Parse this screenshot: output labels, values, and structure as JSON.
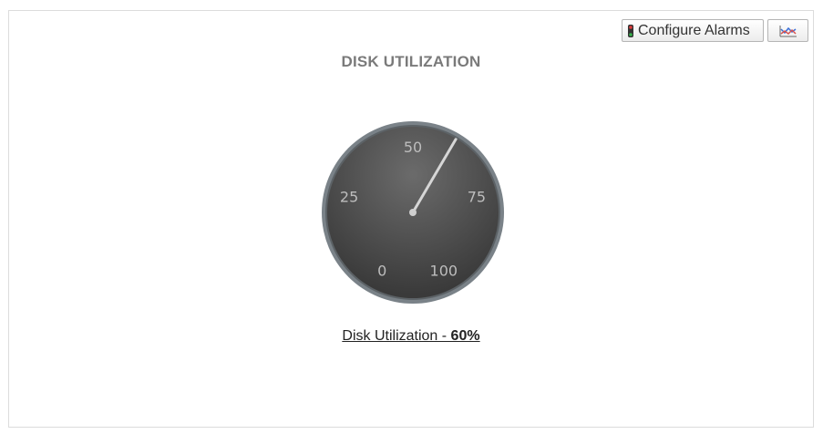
{
  "toolbar": {
    "configure_alarms_label": "Configure Alarms",
    "chart_icon": "line-chart-icon",
    "alarm_icon": "traffic-light-icon"
  },
  "panel": {
    "title": "DISK UTILIZATION",
    "caption_prefix": "Disk Utilization - ",
    "caption_value": "60%"
  },
  "gauge": {
    "value": 60,
    "min": 0,
    "max": 100,
    "tick_labels": [
      "0",
      "25",
      "50",
      "75",
      "100"
    ],
    "colors": {
      "face_center": "#6b6b6b",
      "face_edge": "#3a3a3a",
      "rim": "#7a8288",
      "needle": "#d6d6d6",
      "labels": "#bdbdbd"
    }
  }
}
